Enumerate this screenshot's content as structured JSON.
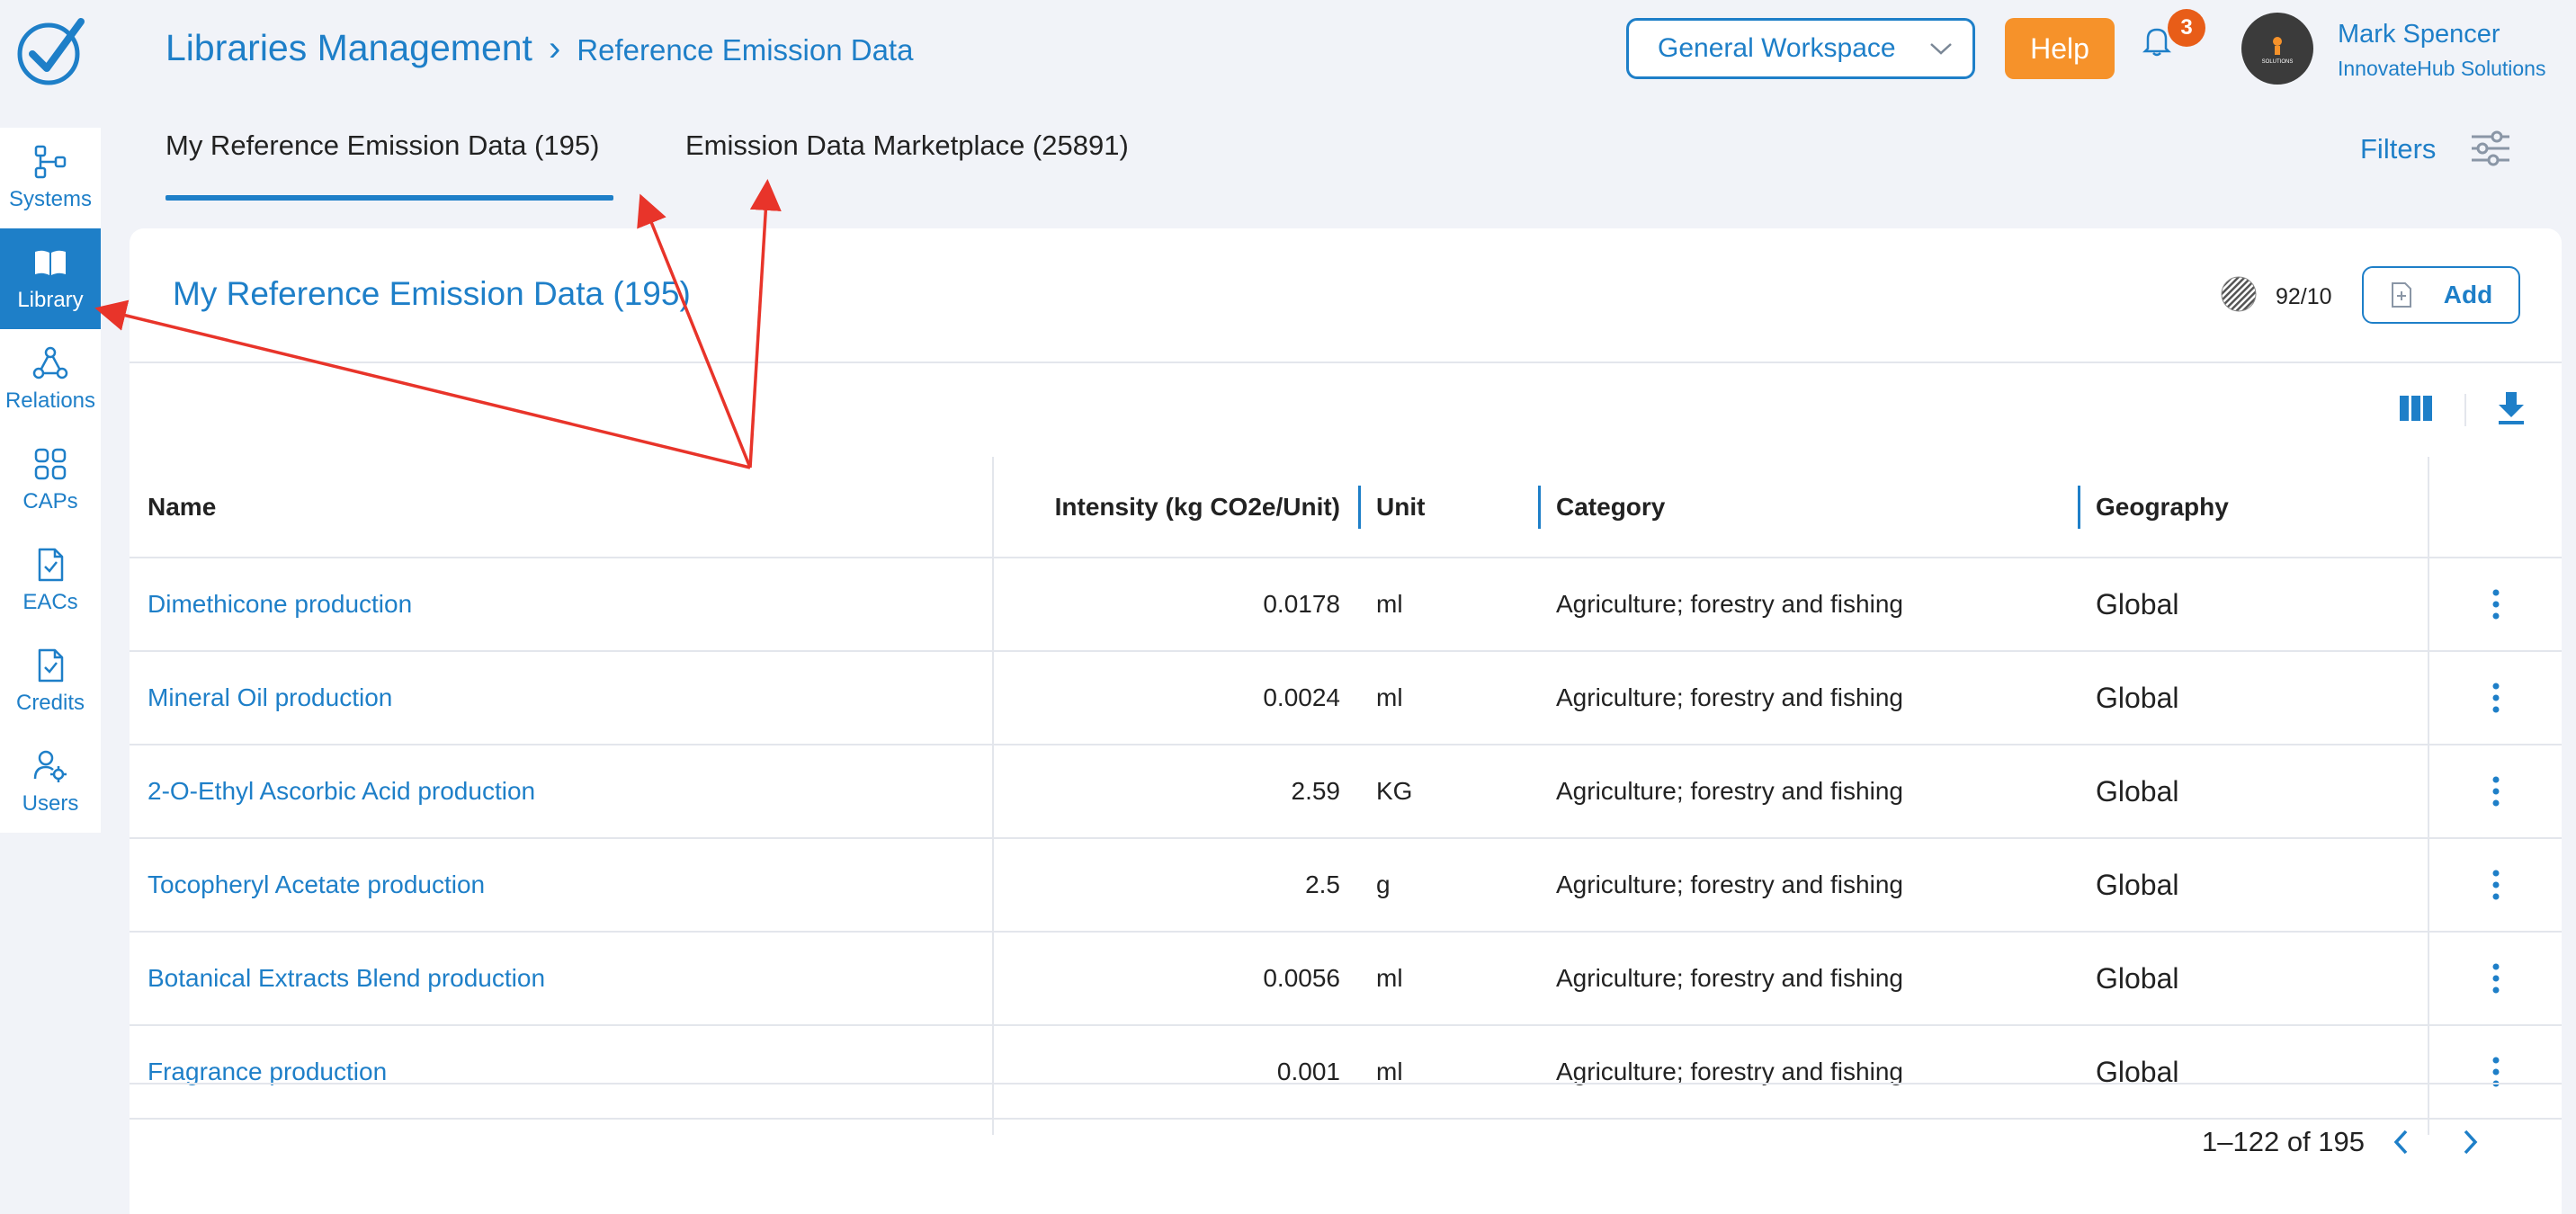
{
  "header": {
    "breadcrumb_root": "Libraries Management",
    "breadcrumb_current": "Reference Emission Data",
    "workspace": "General Workspace",
    "help_label": "Help",
    "notification_count": "3",
    "user_name": "Mark Spencer",
    "user_org": "InnovateHub Solutions",
    "avatar_text": "SOLUTIONS"
  },
  "tabs": [
    {
      "label": "My Reference Emission Data (195)",
      "active": true
    },
    {
      "label": "Emission Data Marketplace (25891)",
      "active": false
    }
  ],
  "filters_label": "Filters",
  "sidebar": {
    "items": [
      {
        "label": "Systems",
        "icon": "systems-icon"
      },
      {
        "label": "Library",
        "icon": "book-icon",
        "active": true
      },
      {
        "label": "Relations",
        "icon": "relations-icon"
      },
      {
        "label": "CAPs",
        "icon": "grid-icon"
      },
      {
        "label": "EACs",
        "icon": "document-check-icon"
      },
      {
        "label": "Credits",
        "icon": "document-check-icon"
      },
      {
        "label": "Users",
        "icon": "users-gear-icon"
      }
    ]
  },
  "card": {
    "title": "My Reference Emission Data (195)",
    "usage": "92/10",
    "add_label": "Add"
  },
  "table": {
    "columns": [
      "Name",
      "Intensity (kg CO2e/Unit)",
      "Unit",
      "Category",
      "Geography"
    ],
    "rows": [
      {
        "name": "Dimethicone production",
        "intensity": "0.0178",
        "unit": "ml",
        "category": "Agriculture; forestry and fishing",
        "geography": "Global"
      },
      {
        "name": "Mineral Oil production",
        "intensity": "0.0024",
        "unit": "ml",
        "category": "Agriculture; forestry and fishing",
        "geography": "Global"
      },
      {
        "name": "2-O-Ethyl Ascorbic Acid production",
        "intensity": "2.59",
        "unit": "KG",
        "category": "Agriculture; forestry and fishing",
        "geography": "Global"
      },
      {
        "name": "Tocopheryl Acetate production",
        "intensity": "2.5",
        "unit": "g",
        "category": "Agriculture; forestry and fishing",
        "geography": "Global"
      },
      {
        "name": "Botanical Extracts Blend production",
        "intensity": "0.0056",
        "unit": "ml",
        "category": "Agriculture; forestry and fishing",
        "geography": "Global"
      },
      {
        "name": "Fragrance production",
        "intensity": "0.001",
        "unit": "ml",
        "category": "Agriculture; forestry and fishing",
        "geography": "Global"
      }
    ]
  },
  "pagination": {
    "range": "1–122 of 195"
  },
  "colors": {
    "primary": "#1e7fc8",
    "help": "#f6922a",
    "badge": "#e85d18",
    "annotation": "#e8342a"
  }
}
